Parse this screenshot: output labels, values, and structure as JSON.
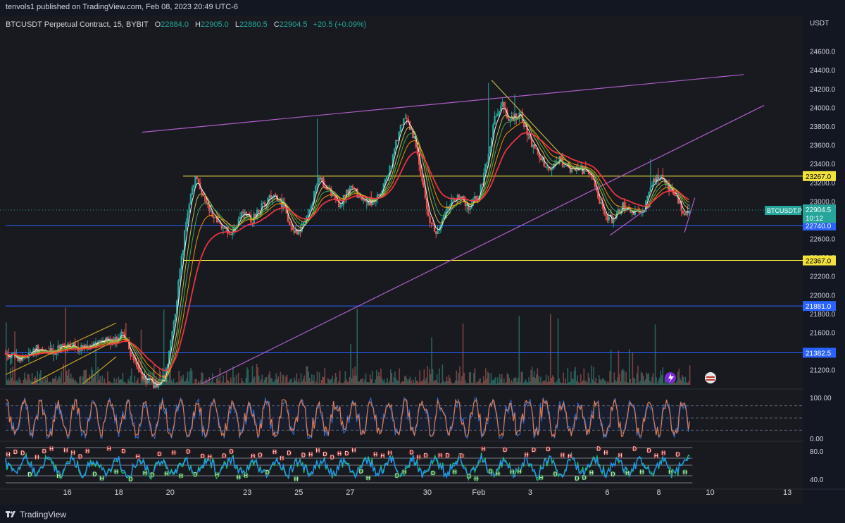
{
  "header": {
    "publish_line": "tenvols1 published on TradingView.com, Feb 08, 2023 20:49 UTC-6"
  },
  "legend": {
    "symbol": "BTCUSDT Perpetual Contract, 15, BYBIT",
    "open_label": "O",
    "open": "22884.0",
    "high_label": "H",
    "high": "22905.0",
    "low_label": "L",
    "low": "22880.5",
    "close_label": "C",
    "close": "22904.5",
    "change": "+20.5 (+0.09%)"
  },
  "footer": {
    "brand": "TradingView"
  },
  "colors": {
    "background": "#181a20",
    "up": "#26a69a",
    "down": "#ef5350",
    "yellow_level": "#f2e23c",
    "blue_level": "#2962ff",
    "trend": "#b05cc9",
    "ema_red": "#f23645",
    "ema_orange": "#ff9800",
    "ema_green": "#4caf50",
    "ema_white": "#ffffff",
    "stoch_orange": "#e07a4f",
    "stoch_blue": "#2e6fd9"
  },
  "chart_data": {
    "type": "candlestick",
    "symbol": "BTCUSDT Perpetual Contract, 15, BYBIT",
    "currency": "USDT",
    "ylim": [
      21040,
      24830
    ],
    "y_ticks": [
      "24600.0",
      "24400.0",
      "24200.0",
      "24000.0",
      "23800.0",
      "23600.0",
      "23400.0",
      "23200.0",
      "23000.0",
      "22800.0",
      "22600.0",
      "22400.0",
      "22200.0",
      "22000.0",
      "21800.0",
      "21600.0",
      "21400.0",
      "21200.0"
    ],
    "y_tick_values": [
      24600,
      24400,
      24200,
      24000,
      23800,
      23600,
      23400,
      23200,
      23000,
      22800,
      22600,
      22400,
      22200,
      22000,
      21800,
      21600,
      21400,
      21200
    ],
    "x_ticks": [
      "16",
      "18",
      "20",
      "23",
      "25",
      "27",
      "30",
      "Feb",
      "3",
      "6",
      "8",
      "10",
      "13"
    ],
    "x_tick_days": [
      16,
      18,
      20,
      23,
      25,
      27,
      30,
      32,
      34,
      37,
      39,
      41,
      44
    ],
    "price_path": [
      [
        13.6,
        21380
      ],
      [
        14.2,
        21300
      ],
      [
        14.8,
        21420
      ],
      [
        15.4,
        21390
      ],
      [
        16.0,
        21460
      ],
      [
        16.6,
        21420
      ],
      [
        17.2,
        21520
      ],
      [
        17.8,
        21490
      ],
      [
        18.2,
        21600
      ],
      [
        18.5,
        21350
      ],
      [
        19.0,
        21100
      ],
      [
        19.4,
        21040
      ],
      [
        19.8,
        21120
      ],
      [
        20.1,
        21600
      ],
      [
        20.4,
        22300
      ],
      [
        20.7,
        22950
      ],
      [
        21.0,
        23300
      ],
      [
        21.3,
        23050
      ],
      [
        21.6,
        22850
      ],
      [
        22.0,
        22700
      ],
      [
        22.4,
        22650
      ],
      [
        22.8,
        22900
      ],
      [
        23.2,
        22800
      ],
      [
        23.6,
        22950
      ],
      [
        24.0,
        23100
      ],
      [
        24.4,
        22950
      ],
      [
        24.8,
        22650
      ],
      [
        25.1,
        22700
      ],
      [
        25.4,
        22900
      ],
      [
        25.8,
        23250
      ],
      [
        26.2,
        23100
      ],
      [
        26.6,
        22950
      ],
      [
        27.0,
        23150
      ],
      [
        27.4,
        23050
      ],
      [
        27.8,
        22980
      ],
      [
        28.2,
        23100
      ],
      [
        28.6,
        23400
      ],
      [
        28.9,
        23750
      ],
      [
        29.2,
        23900
      ],
      [
        29.5,
        23650
      ],
      [
        29.8,
        23200
      ],
      [
        30.1,
        22800
      ],
      [
        30.4,
        22650
      ],
      [
        30.8,
        22950
      ],
      [
        31.2,
        23050
      ],
      [
        31.6,
        22950
      ],
      [
        32.0,
        23050
      ],
      [
        32.3,
        23400
      ],
      [
        32.6,
        23850
      ],
      [
        32.9,
        24050
      ],
      [
        33.2,
        23850
      ],
      [
        33.6,
        23950
      ],
      [
        33.9,
        23700
      ],
      [
        34.3,
        23500
      ],
      [
        34.7,
        23350
      ],
      [
        35.1,
        23450
      ],
      [
        35.5,
        23350
      ],
      [
        35.9,
        23350
      ],
      [
        36.3,
        23300
      ],
      [
        36.6,
        23100
      ],
      [
        36.9,
        22850
      ],
      [
        37.2,
        22800
      ],
      [
        37.6,
        22950
      ],
      [
        38.0,
        22850
      ],
      [
        38.4,
        22900
      ],
      [
        38.8,
        23200
      ],
      [
        39.1,
        23300
      ],
      [
        39.4,
        23150
      ],
      [
        39.8,
        23000
      ],
      [
        40.0,
        22830
      ],
      [
        40.2,
        22904.5
      ]
    ],
    "horizontal_levels": [
      {
        "price": 23267.0,
        "label": "23267.0",
        "color": "#f2e23c",
        "x_start_day": 20.5
      },
      {
        "price": 22367.0,
        "label": "22367.0",
        "color": "#f2e23c",
        "x_start_day": 20.5
      },
      {
        "price": 22740.0,
        "label": "22740.0",
        "color": "#2962ff",
        "x_start_day": 13.6
      },
      {
        "price": 21881.0,
        "label": "21881.0",
        "color": "#2962ff",
        "x_start_day": 13.6
      },
      {
        "price": 21382.5,
        "label": "21382.5",
        "color": "#2962ff",
        "x_start_day": 13.6
      }
    ],
    "trend_lines": [
      {
        "from": [
          18.9,
          23735
        ],
        "to": [
          42.3,
          24350
        ],
        "color": "#b05cc9"
      },
      {
        "from": [
          21.2,
          21050
        ],
        "to": [
          43.1,
          24022
        ],
        "color": "#b05cc9"
      },
      {
        "from": [
          32.5,
          24290
        ],
        "to": [
          35.8,
          23320
        ],
        "color": "#b8b04a"
      },
      {
        "from": [
          37.1,
          22635
        ],
        "to": [
          38.7,
          22950
        ],
        "color": "#b05cc9"
      },
      {
        "from": [
          40.0,
          22665
        ],
        "to": [
          40.4,
          23035
        ],
        "color": "#b05cc9"
      },
      {
        "from": [
          13.6,
          21150
        ],
        "to": [
          17.9,
          21700
        ],
        "color": "#c9a227"
      },
      {
        "from": [
          14.6,
          21050
        ],
        "to": [
          17.9,
          21520
        ],
        "color": "#c9a227"
      },
      {
        "from": [
          16.6,
          21050
        ],
        "to": [
          17.9,
          21340
        ],
        "color": "#c9a227"
      }
    ],
    "last_price": {
      "label": "BTCUSDT.P",
      "value": "22904.5",
      "countdown": "10:12"
    },
    "oscillator_1": {
      "ticks": [
        "100.00",
        "0.00"
      ],
      "tick_values": [
        100,
        0
      ],
      "band": [
        80,
        20
      ]
    },
    "oscillator_2": {
      "ticks": [
        "80.0",
        "40.0"
      ],
      "tick_values": [
        80,
        40
      ],
      "marker_letters": [
        "H",
        "D"
      ]
    }
  }
}
